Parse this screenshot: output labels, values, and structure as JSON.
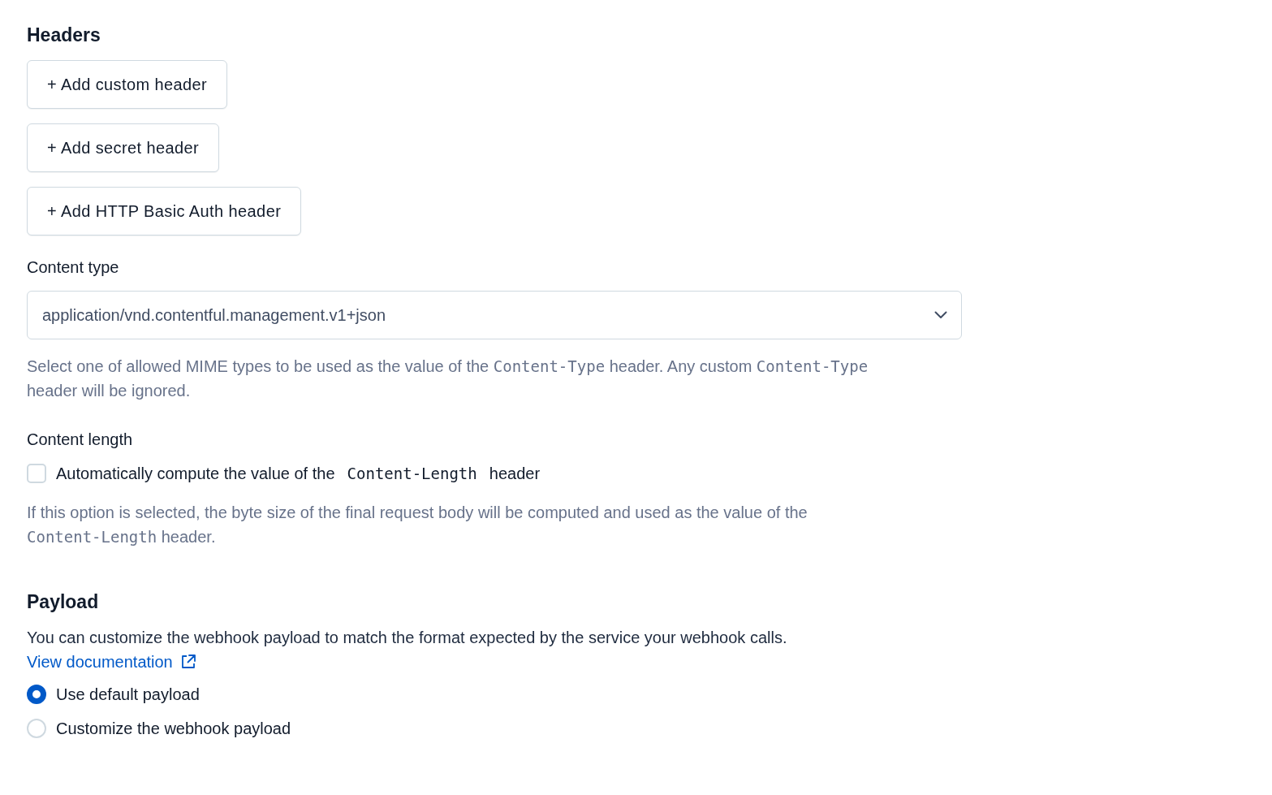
{
  "headers": {
    "title": "Headers",
    "buttons": [
      {
        "label": "+ Add custom header"
      },
      {
        "label": "+ Add secret header"
      },
      {
        "label": "+ Add HTTP Basic Auth header"
      }
    ]
  },
  "content_type": {
    "label": "Content type",
    "select": {
      "value": "application/vnd.contentful.management.v1+json"
    },
    "help": [
      {
        "kind": "text",
        "text": "Select one of allowed MIME types to be used as the value of the "
      },
      {
        "kind": "code",
        "text": "Content-Type"
      },
      {
        "kind": "text",
        "text": " header. Any custom "
      },
      {
        "kind": "code",
        "text": "Content-Type"
      },
      {
        "kind": "text",
        "text": " header will be ignored."
      }
    ]
  },
  "content_length": {
    "label": "Content length",
    "checkbox": {
      "checked": false,
      "label": [
        {
          "kind": "text",
          "text": "Automatically compute the value of the "
        },
        {
          "kind": "code",
          "text": "Content-Length"
        },
        {
          "kind": "text",
          "text": " header"
        }
      ]
    },
    "help": [
      {
        "kind": "text",
        "text": "If this option is selected, the byte size of the final request body will be computed and used as the value of the "
      },
      {
        "kind": "code",
        "text": "Content-Length"
      },
      {
        "kind": "text",
        "text": " header."
      }
    ]
  },
  "payload": {
    "title": "Payload",
    "description": "You can customize the webhook payload to match the format expected by the service your webhook calls.",
    "link": {
      "label": "View documentation"
    },
    "options": [
      {
        "label": "Use default payload",
        "selected": true
      },
      {
        "label": "Customize the webhook payload",
        "selected": false
      }
    ]
  }
}
